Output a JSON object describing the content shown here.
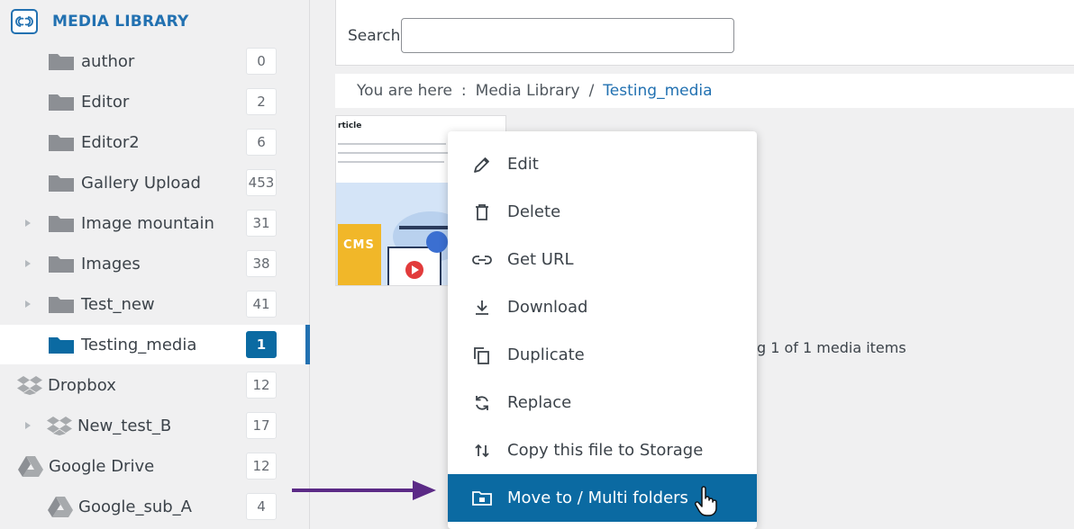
{
  "sidebar": {
    "title": "MEDIA LIBRARY",
    "items": [
      {
        "label": "author",
        "count": "0"
      },
      {
        "label": "Editor",
        "count": "2"
      },
      {
        "label": "Editor2",
        "count": "6"
      },
      {
        "label": "Gallery Upload",
        "count": "453"
      },
      {
        "label": "Image mountain",
        "count": "31"
      },
      {
        "label": "Images",
        "count": "38"
      },
      {
        "label": "Test_new",
        "count": "41"
      },
      {
        "label": "Testing_media",
        "count": "1"
      },
      {
        "label": "Dropbox",
        "count": "12"
      },
      {
        "label": "New_test_B",
        "count": "17"
      },
      {
        "label": "Google Drive",
        "count": "12"
      },
      {
        "label": "Google_sub_A",
        "count": "4"
      }
    ]
  },
  "search": {
    "label": "Search",
    "value": ""
  },
  "breadcrumb": {
    "prefix": "You are here",
    "separator": ":",
    "root": "Media Library",
    "slash": "/",
    "current": "Testing_media"
  },
  "thumbnail": {
    "title": "rticle",
    "badge": "CMS"
  },
  "status": "g 1 of 1 media items",
  "context_menu": {
    "items": [
      {
        "label": "Edit",
        "icon": "pencil-icon"
      },
      {
        "label": "Delete",
        "icon": "trash-icon"
      },
      {
        "label": "Get URL",
        "icon": "link-icon"
      },
      {
        "label": "Download",
        "icon": "download-icon"
      },
      {
        "label": "Duplicate",
        "icon": "duplicate-icon"
      },
      {
        "label": "Replace",
        "icon": "replace-icon"
      },
      {
        "label": "Copy this file to Storage",
        "icon": "storage-copy-icon"
      },
      {
        "label": "Move to / Multi folders",
        "icon": "move-folder-icon"
      }
    ]
  },
  "colors": {
    "accent": "#0b6aa2",
    "link": "#2271b1",
    "annotation_arrow": "#5b2a86"
  }
}
